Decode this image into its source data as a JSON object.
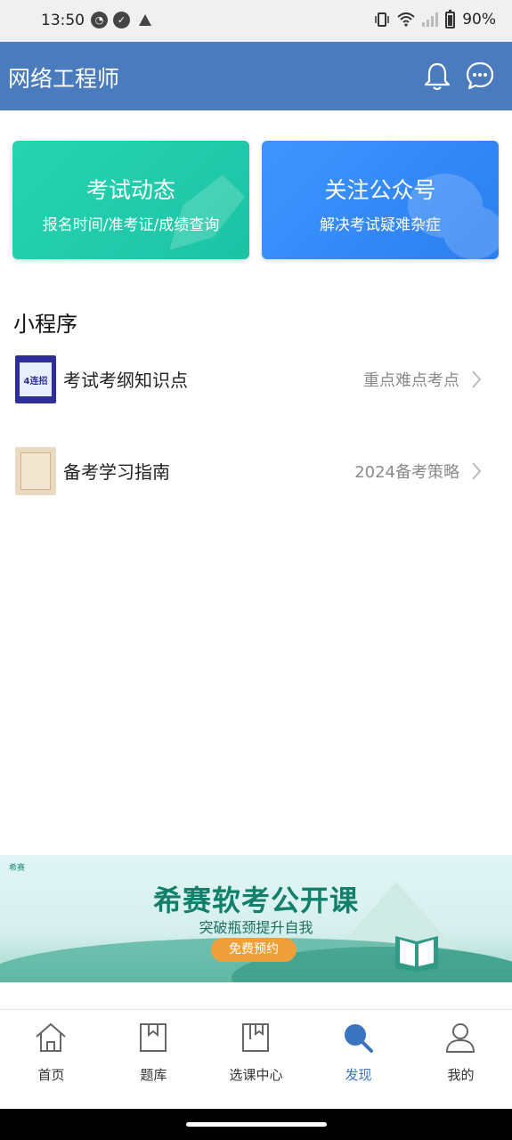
{
  "status_bar": {
    "time": "13:50",
    "battery_percent": "90%"
  },
  "header": {
    "title": "网络工程师",
    "icons": [
      "bell-icon",
      "chat-icon"
    ]
  },
  "cards": [
    {
      "title": "考试动态",
      "subtitle": "报名时间/准考证/成绩查询",
      "color": "#1fcaa9"
    },
    {
      "title": "关注公众号",
      "subtitle": "解决考试疑难杂症",
      "color": "#338aff"
    }
  ],
  "mini_programs": {
    "section_title": "小程序",
    "items": [
      {
        "name": "考试考纲知识点",
        "tag": "重点难点考点",
        "thumb_text": "4连招"
      },
      {
        "name": "备考学习指南",
        "tag": "2024备考策略"
      }
    ]
  },
  "banner": {
    "logo": "希赛",
    "title": "希赛软考公开课",
    "subtitle": "突破瓶颈提升自我",
    "button": "免费预约"
  },
  "nav": {
    "items": [
      {
        "label": "首页",
        "icon": "home-icon"
      },
      {
        "label": "题库",
        "icon": "question-bank-icon"
      },
      {
        "label": "选课中心",
        "icon": "course-center-icon"
      },
      {
        "label": "发现",
        "icon": "search-icon",
        "active": true
      },
      {
        "label": "我的",
        "icon": "profile-icon"
      }
    ],
    "active_color": "#3a73c0"
  }
}
